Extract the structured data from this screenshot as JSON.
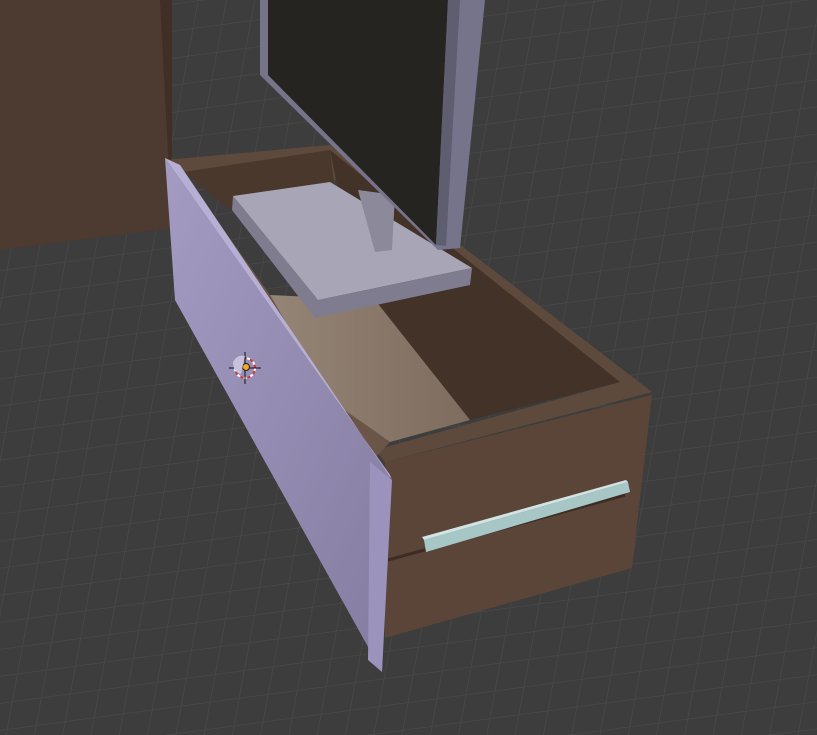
{
  "viewport": {
    "kind": "3d-viewport",
    "background_color": "#3d3d3d",
    "grid_color": "#4a4a4a"
  },
  "scene": {
    "objects": [
      {
        "name": "wall-panel",
        "color": "#4d3a30"
      },
      {
        "name": "drawer-cabinet",
        "color": "#5a4538"
      },
      {
        "name": "drawer-interior",
        "color": "#433228"
      },
      {
        "name": "drawer-bottom",
        "color": "#8c7a6c"
      },
      {
        "name": "drawer-front",
        "color": "#8f86ad",
        "selected": true
      },
      {
        "name": "rail",
        "color": "#a7c6c6"
      },
      {
        "name": "monitor",
        "color": "#262420"
      },
      {
        "name": "monitor-stand",
        "color": "#a8a6b6"
      }
    ]
  },
  "gizmo": {
    "icon": "3d-cursor-icon",
    "ring_colors": [
      "#ffffff",
      "#d93030"
    ],
    "origin_color": "#f5a623"
  }
}
